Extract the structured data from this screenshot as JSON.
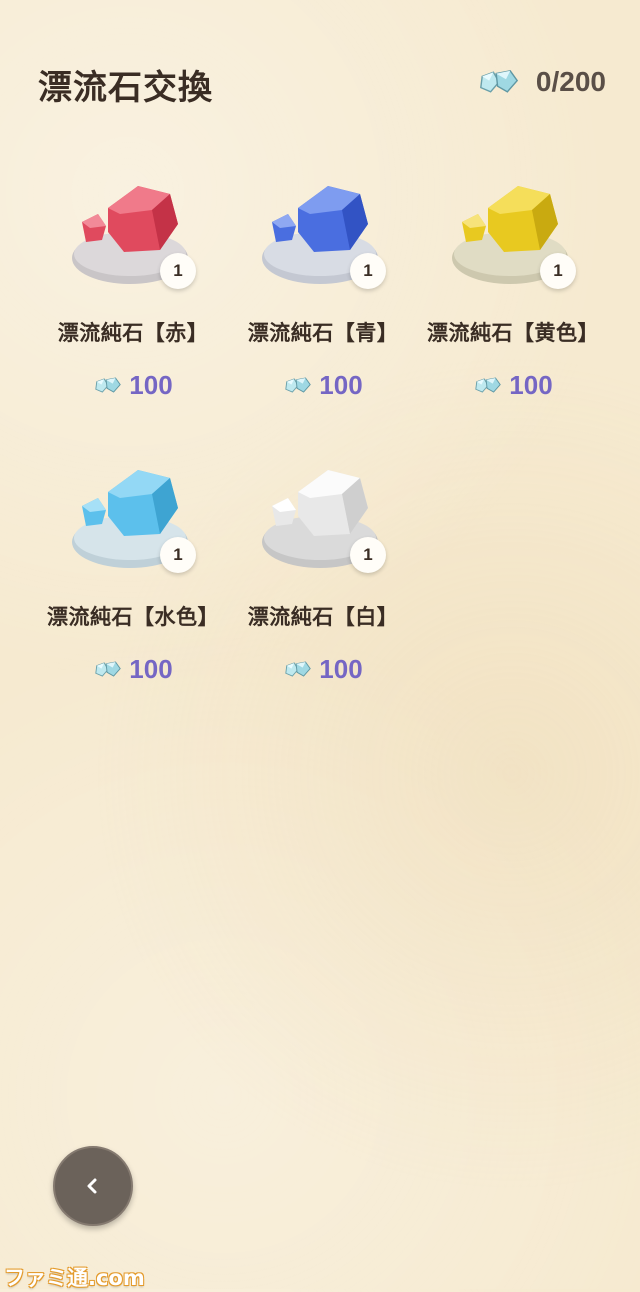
{
  "header": {
    "title": "漂流石交換",
    "currency_icon": "crystal-icon",
    "balance": "0/200"
  },
  "items": [
    {
      "name": "漂流純石【赤】",
      "count": "1",
      "price": "100",
      "color": "#e04a5e"
    },
    {
      "name": "漂流純石【青】",
      "count": "1",
      "price": "100",
      "color": "#4a6ee0"
    },
    {
      "name": "漂流純石【黄色】",
      "count": "1",
      "price": "100",
      "color": "#e8c920"
    },
    {
      "name": "漂流純石【水色】",
      "count": "1",
      "price": "100",
      "color": "#5cc0ec"
    },
    {
      "name": "漂流純石【白】",
      "count": "1",
      "price": "100",
      "color": "#e8e8e8"
    }
  ],
  "back_button": {
    "icon": "chevron-left-icon"
  },
  "watermark": "ファミ通.com"
}
